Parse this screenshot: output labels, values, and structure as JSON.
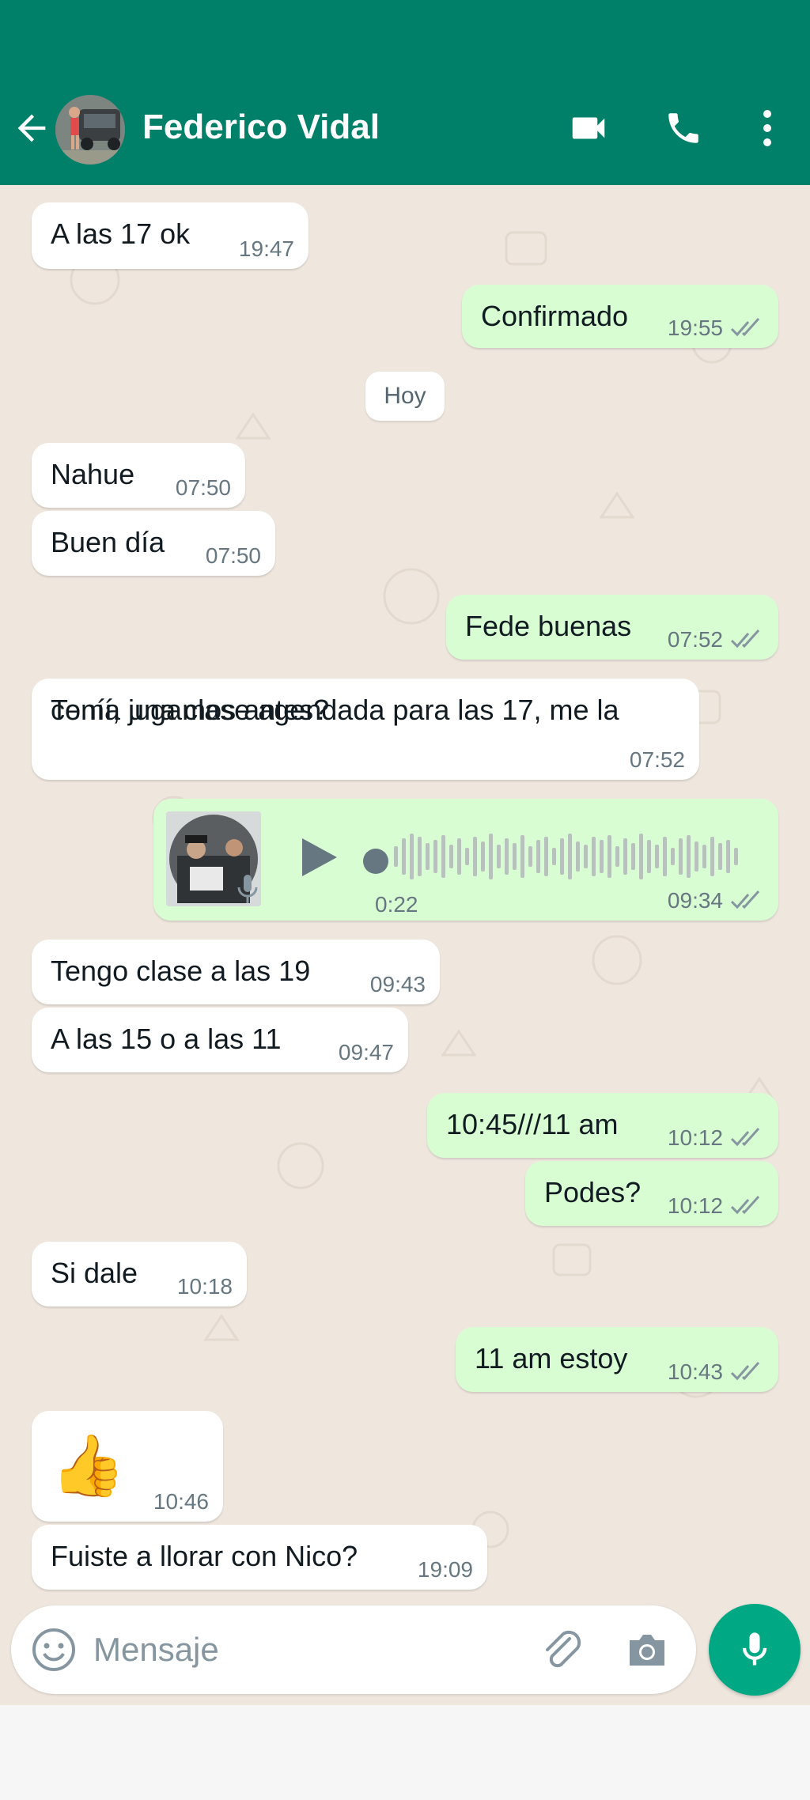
{
  "header": {
    "contact_name": "Federico Vidal",
    "icons": [
      "back-arrow-icon",
      "video-call-icon",
      "phone-icon",
      "more-options-icon"
    ]
  },
  "colors": {
    "header": "#008069",
    "chat_background": "#efe7de",
    "incoming_bubble": "#ffffff",
    "outgoing_bubble": "#d9fdd3",
    "read_ticks": "#53bdeb",
    "mic_button": "#00a884"
  },
  "day_separator": "Hoy",
  "messages": [
    {
      "direction": "in",
      "text": "A las 17 ok",
      "time": "19:47"
    },
    {
      "direction": "out",
      "text": "Confirmado",
      "time": "19:55",
      "status": "read"
    },
    {
      "direction": "in",
      "text": "Nahue",
      "time": "07:50"
    },
    {
      "direction": "in",
      "text": "Buen día",
      "time": "07:50"
    },
    {
      "direction": "out",
      "text": "Fede buenas",
      "time": "07:52",
      "status": "read"
    },
    {
      "direction": "in",
      "text_line1": "Tenía una clase agendada para las 17, me la",
      "text_line2": "comí, jugamos antes?",
      "time": "07:52"
    },
    {
      "direction": "out",
      "type": "voice",
      "duration": "0:22",
      "time": "09:34",
      "status": "read"
    },
    {
      "direction": "in",
      "text": "Tengo clase a las 19",
      "time": "09:43"
    },
    {
      "direction": "in",
      "text": "A las 15 o a las 11",
      "time": "09:47"
    },
    {
      "direction": "out",
      "text": "10:45///11 am",
      "time": "10:12",
      "status": "read"
    },
    {
      "direction": "out",
      "text": "Podes?",
      "time": "10:12",
      "status": "read"
    },
    {
      "direction": "in",
      "text": "Si dale",
      "time": "10:18"
    },
    {
      "direction": "out",
      "text": "11 am estoy",
      "time": "10:43",
      "status": "read"
    },
    {
      "direction": "in",
      "type": "emoji",
      "text": "👍",
      "time": "10:46"
    },
    {
      "direction": "in",
      "text": "Fuiste a llorar con Nico?",
      "time": "19:09"
    }
  ],
  "composer": {
    "placeholder": "Mensaje",
    "icons": [
      "emoji-icon",
      "attach-icon",
      "camera-icon",
      "mic-icon"
    ]
  }
}
